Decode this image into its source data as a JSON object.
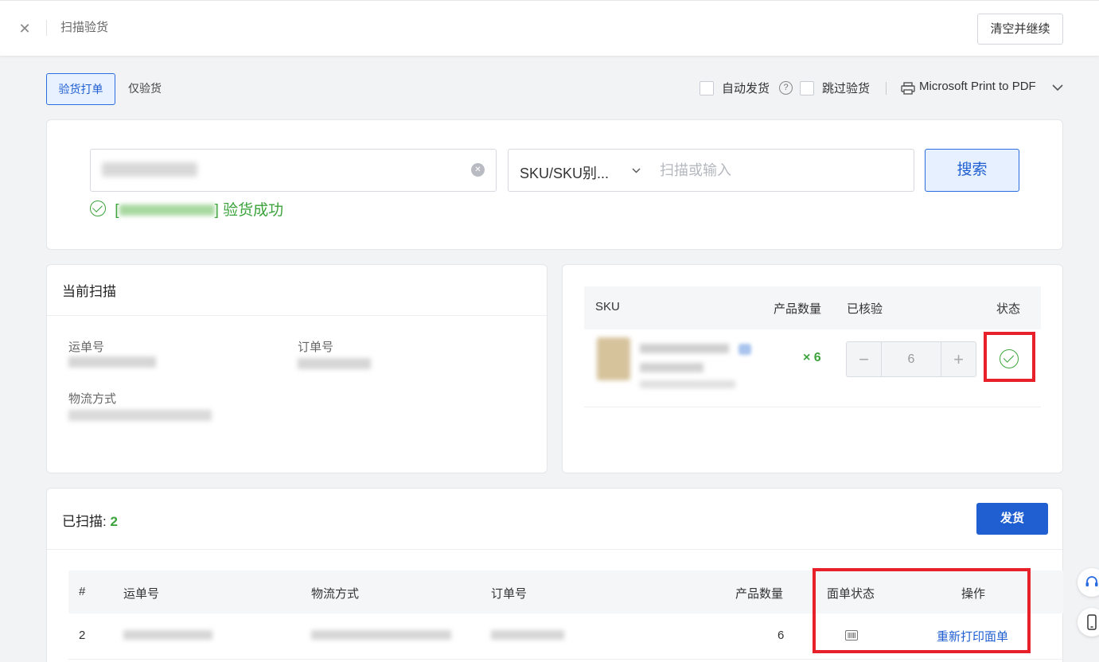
{
  "header": {
    "title": "扫描验货",
    "clear_button": "清空并继续"
  },
  "tabs": [
    {
      "label": "验货打单",
      "active": true
    },
    {
      "label": "仅验货",
      "active": false
    }
  ],
  "options": {
    "auto_ship": "自动发货",
    "skip_check": "跳过验货",
    "printer": "Microsoft Print to PDF"
  },
  "scan": {
    "placeholder": "扫描或输入",
    "select_value": "SKU/SKU别...",
    "search_button": "搜索",
    "success_bracket_open": "[",
    "success_message": "] 验货成功"
  },
  "current": {
    "title": "当前扫描",
    "tracking_label": "运单号",
    "order_label": "订单号",
    "logistics_label": "物流方式"
  },
  "sku_table": {
    "headers": [
      "SKU",
      "产品数量",
      "已核验",
      "状态"
    ],
    "row": {
      "qty": "× 6",
      "checked": "6"
    }
  },
  "scanned": {
    "label": "已扫描:",
    "count": "2",
    "ship_button": "发货",
    "headers": [
      "#",
      "运单号",
      "物流方式",
      "订单号",
      "产品数量",
      "面单状态",
      "操作"
    ],
    "rows": [
      {
        "index": "2",
        "qty": "6",
        "action": "重新打印面单"
      }
    ]
  },
  "colors": {
    "accent": "#1f5fd1",
    "success": "#3ca33c",
    "highlight": "#e8202a"
  }
}
